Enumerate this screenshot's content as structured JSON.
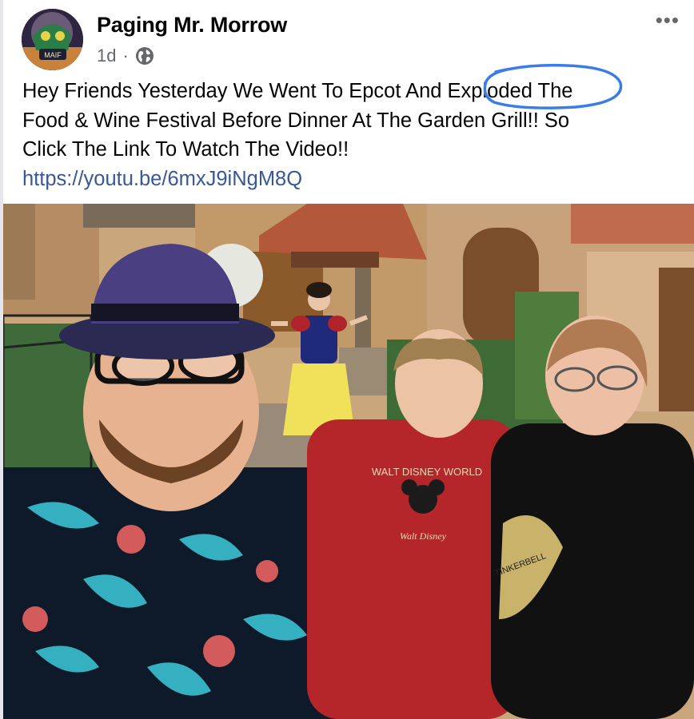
{
  "post": {
    "author": "Paging Mr. Morrow",
    "time": "1d",
    "separator": "·",
    "audience_icon": "globe-icon",
    "more_icon": "more-options-icon",
    "more_label": "•••",
    "text_lines": [
      "Hey Friends Yesterday We Went To Epcot And Exploded The",
      "Food & Wine Festival Before Dinner At The Garden Grill!! So",
      "Click The Link To Watch The Video!!"
    ],
    "link": "https://youtu.be/6mxJ9iNgM8Q"
  },
  "avatar_badge_text": "MAIF",
  "photo": {
    "shirt_text": "WALT DISNEY WORLD",
    "shirt_signature": "Walt Disney",
    "shirt2_text": "TINKERBELL"
  },
  "colors": {
    "text": "#050505",
    "meta": "#65676b",
    "link": "#385898",
    "annotation": "#3b7de6"
  }
}
